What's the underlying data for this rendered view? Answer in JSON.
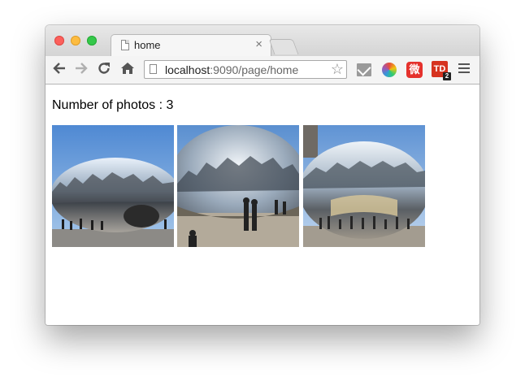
{
  "browser": {
    "tab_title": "home",
    "tab_close": "×",
    "url_host": "localhost",
    "url_rest": ":9090/page/home",
    "extensions": {
      "weibo_label": "微",
      "td_label": "TD",
      "td_badge": "2"
    }
  },
  "page": {
    "count_label": "Number of photos : 3"
  },
  "photos": [
    {
      "name": "cloud-gate-photo-1"
    },
    {
      "name": "cloud-gate-photo-2"
    },
    {
      "name": "cloud-gate-photo-3"
    }
  ],
  "colors": {
    "traffic_close": "#fc605c",
    "traffic_min": "#fdbc40",
    "traffic_max": "#34c84a",
    "sky": "#6ea0d8"
  }
}
